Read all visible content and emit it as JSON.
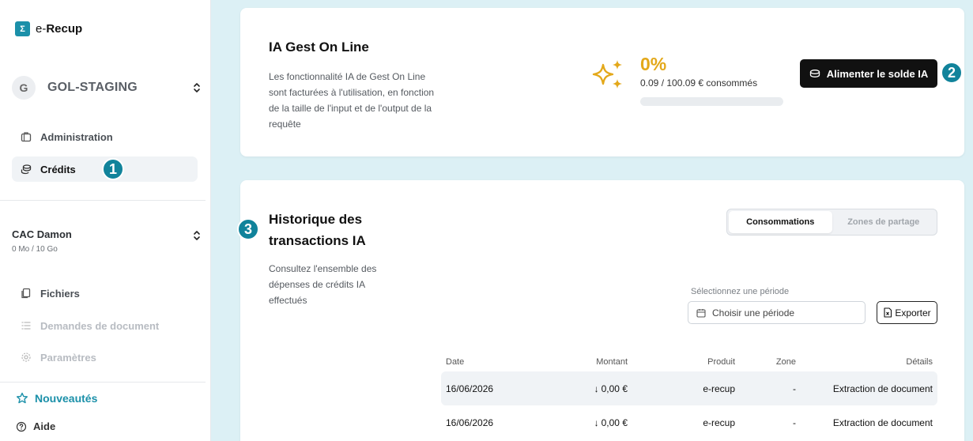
{
  "app": {
    "logo_mark": "Σ",
    "name_prefix": "e-",
    "name_bold": "Recup"
  },
  "org": {
    "avatar_letter": "G",
    "name": "GOL-STAGING"
  },
  "nav_top": [
    {
      "label": "Administration",
      "icon": "briefcase-icon"
    },
    {
      "label": "Crédits",
      "icon": "coins-icon"
    }
  ],
  "workspace": {
    "name": "CAC Damon",
    "quota": "0 Mo / 10 Go"
  },
  "nav_ws": [
    {
      "label": "Fichiers",
      "icon": "files-icon"
    },
    {
      "label": "Demandes de document",
      "icon": "list-icon"
    },
    {
      "label": "Paramètres",
      "icon": "gear-icon"
    }
  ],
  "footer": {
    "news": "Nouveautés",
    "help": "Aide"
  },
  "badges": [
    "1",
    "2",
    "3"
  ],
  "ia_card": {
    "title": "IA Gest On Line",
    "description": "Les fonctionnalité IA de Gest On Line sont facturées à l'utilisation, en fonction de la taille de l'input et de l'output de la requête",
    "percent": "0%",
    "percent_value": 0,
    "consumed": "0.09 / 100.09 € consommés",
    "button": "Alimenter le solde IA"
  },
  "history": {
    "title": "Historique des transactions IA",
    "description": "Consultez l'ensemble des dépenses de crédits IA effectués",
    "tabs": [
      "Consommations",
      "Zones de partage"
    ],
    "period_label": "Sélectionnez une période",
    "period_placeholder": "Choisir une période",
    "export": "Exporter",
    "columns": [
      "Date",
      "Montant",
      "Produit",
      "Zone",
      "Détails"
    ],
    "rows": [
      {
        "date": "16/06/2026",
        "amount": "0,00 €",
        "product": "e-recup",
        "zone": "-",
        "details": "Extraction de document"
      },
      {
        "date": "16/06/2026",
        "amount": "0,00 €",
        "product": "e-recup",
        "zone": "-",
        "details": "Extraction de document"
      }
    ]
  },
  "colors": {
    "accent": "#1b90a9",
    "badge": "#11839b",
    "gold": "#e3a81a",
    "background": "#dcf0f5"
  }
}
